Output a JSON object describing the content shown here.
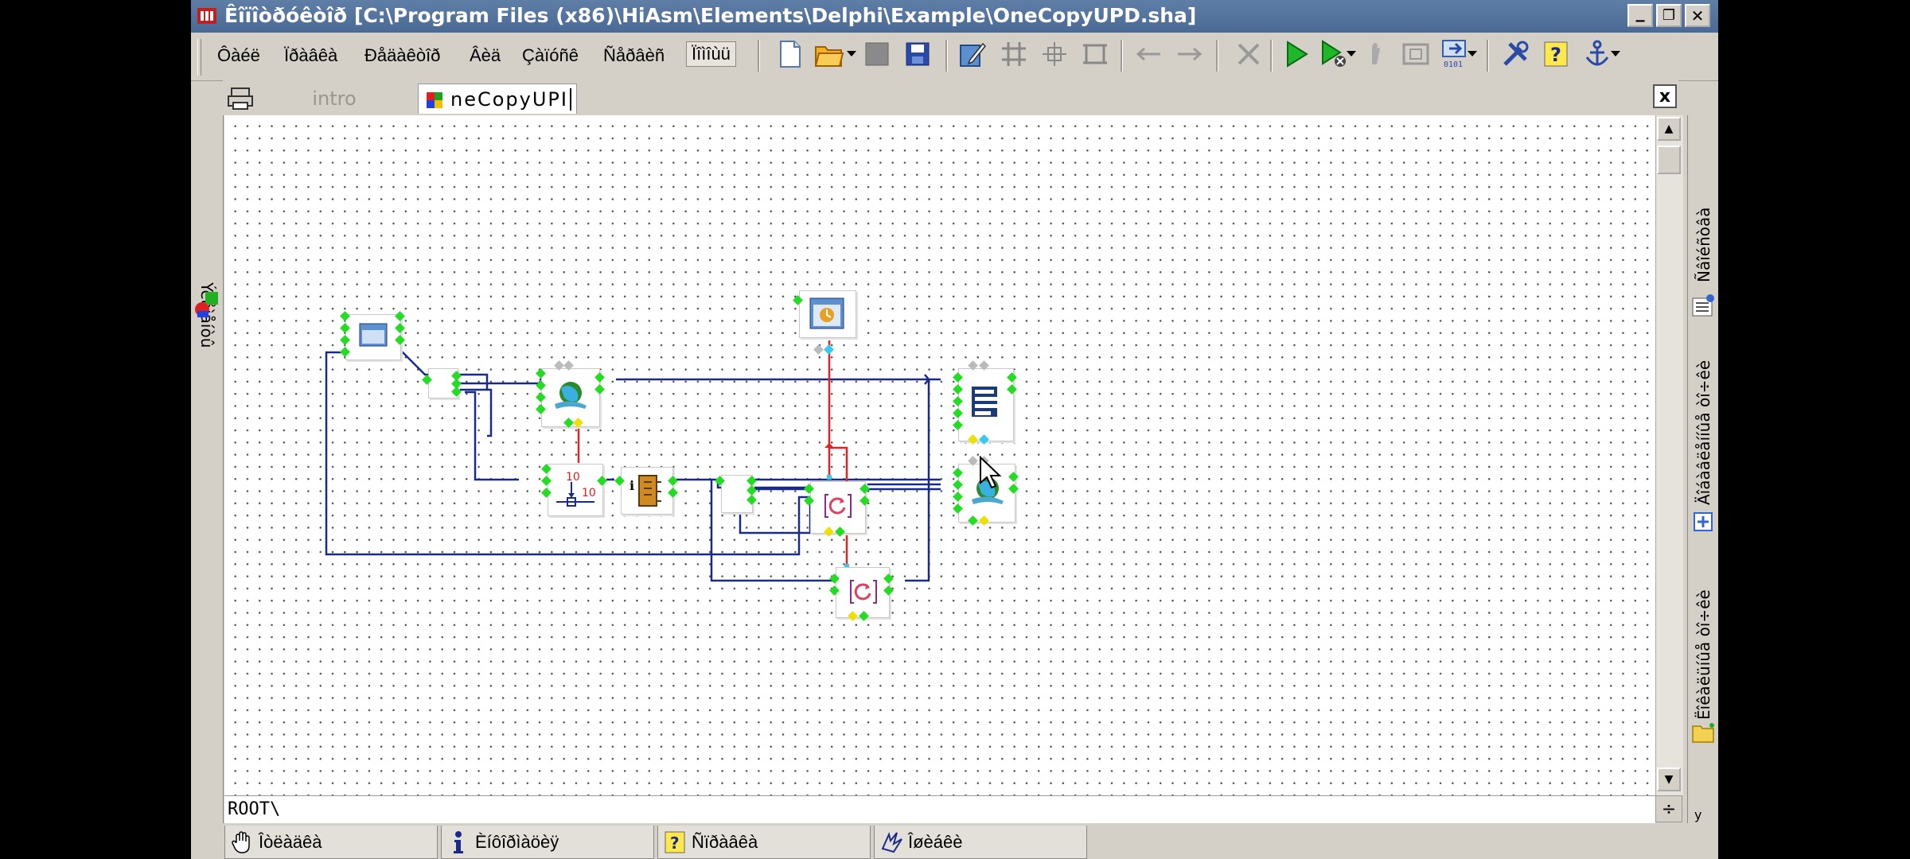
{
  "window": {
    "title": "Êîïîòðóêòîð [C:\\Program Files (x86)\\HiAsm\\Elements\\Delphi\\Example\\OneCopyUPD.sha]",
    "minimize": "▁",
    "restore": "❐",
    "close": "✕"
  },
  "menu": {
    "items": [
      "Ôàéë",
      "Ïðàâêà",
      "Ðåäàêòîð",
      "Âèä",
      "Çàïóñê",
      "Ñåðâèñ",
      "Ïîìîùü"
    ]
  },
  "toolbar": {
    "buttons": [
      "new-file-icon",
      "open-folder-icon",
      "dropdown-arrow-icon",
      "disk-icon",
      "save-icon",
      "edit-icon",
      "grid-icon",
      "align-icon",
      "frame-icon",
      "arrow-left-icon",
      "arrow-right-icon",
      "delete-icon",
      "run-icon",
      "debug-run-icon",
      "dropdown-arrow-icon",
      "step-icon",
      "stop-icon",
      "compile-icon",
      "dropdown-arrow-icon",
      "tools-icon",
      "help-icon",
      "anchor-icon",
      "dropdown-arrow-icon"
    ]
  },
  "tabs": [
    {
      "label": "intro",
      "active": false
    },
    {
      "label": "neCopyUPI",
      "active": true
    }
  ],
  "tab_close": "x",
  "left_panel": {
    "label": "Ýëåìåíòû"
  },
  "right_panel": {
    "labels": [
      "Ñâîéñòâà",
      "Äîáàâëåííûå òî÷êè",
      "Ëîêàëüíûå òî÷êè"
    ]
  },
  "path": "ROOT\\",
  "bottom_tabs": [
    {
      "label": "Îòëàäêà",
      "icon": "hand-icon"
    },
    {
      "label": "Èíôîðìàöèÿ",
      "icon": "info-icon"
    },
    {
      "label": "Ñïðàâêà",
      "icon": "help-icon"
    },
    {
      "label": "Îøèáêè",
      "icon": "error-icon"
    }
  ],
  "colors": {
    "wire_blue": "#1a2a8a",
    "wire_red": "#e82020",
    "pin_green": "#22dd22",
    "pin_yellow": "#f0e000",
    "pin_cyan": "#33ccee",
    "titlebar": "#4f6f9c"
  },
  "elements": [
    "form-element",
    "hub-element",
    "network-element",
    "timer-element",
    "text-block-element",
    "counter-element",
    "info-element",
    "hub-element-2",
    "loop-element",
    "network-element-2",
    "loop-element-2"
  ]
}
